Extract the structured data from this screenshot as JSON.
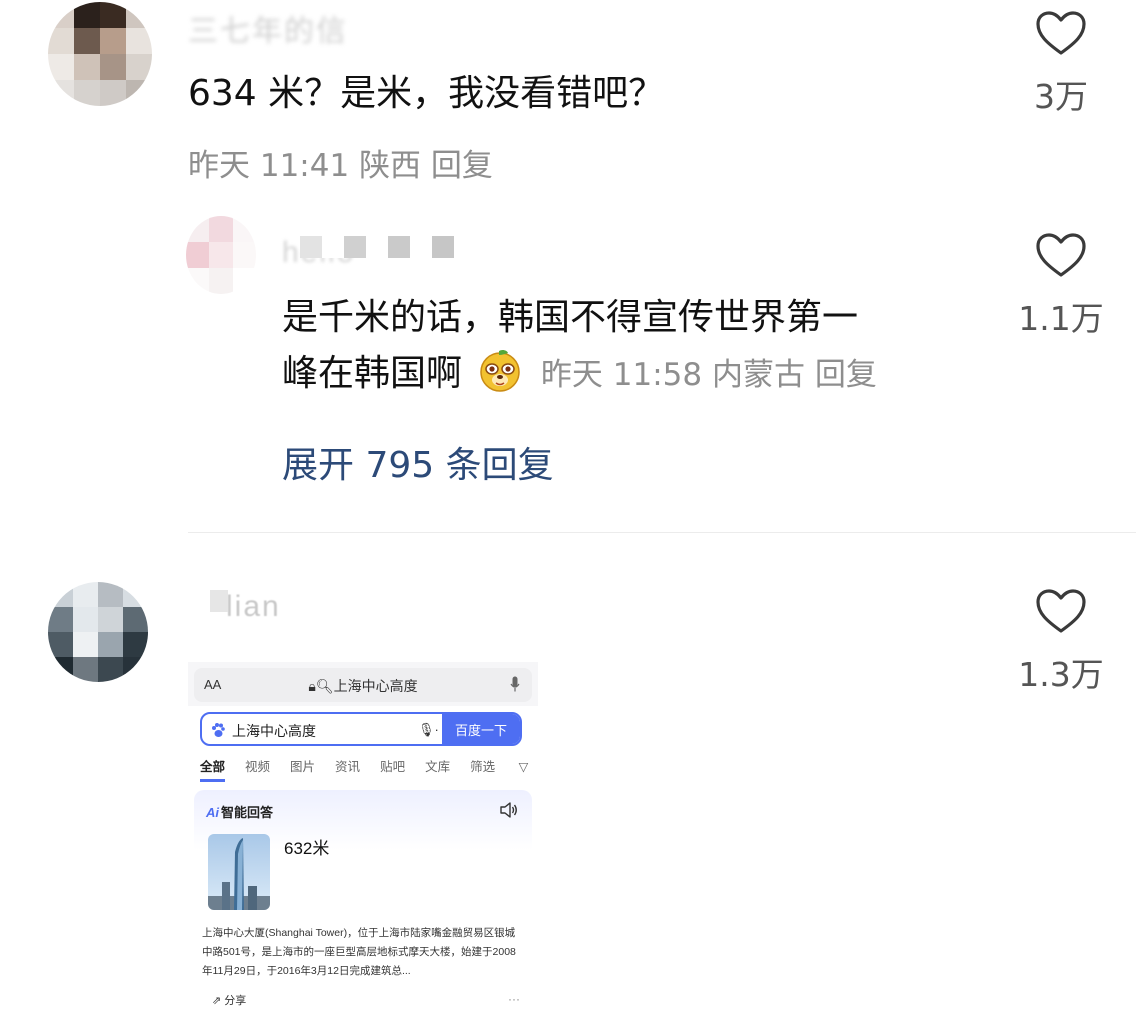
{
  "comments": [
    {
      "username": "三七年的信",
      "text": "634 米？是米，我没看错吧？",
      "time": "昨天 11:41",
      "location": "陕西",
      "reply_label": "回复",
      "likes": "3万"
    }
  ],
  "reply": {
    "username": "hello",
    "text_line1": "是千米的话，韩国不得宣传世界第一",
    "text_line2": "峰在韩国啊",
    "emoji": "dog-face-emoji",
    "time": "昨天 11:58",
    "location": "内蒙古",
    "reply_label": "回复",
    "likes": "1.1万",
    "expand_label": "展开 795 条回复"
  },
  "comment2": {
    "username": "lian",
    "likes": "1.3万",
    "image": {
      "address_aa": "AA",
      "address_url": "上海中心高度",
      "search_query": "上海中心高度",
      "search_button": "百度一下",
      "tabs": [
        "全部",
        "视频",
        "图片",
        "资讯",
        "贴吧",
        "文库"
      ],
      "filter_label": "筛选",
      "ai_badge": "Ai",
      "ai_title": "智能回答",
      "answer": "632米",
      "description": "上海中心大厦(Shanghai Tower)，位于上海市陆家嘴金融贸易区银城中路501号，是上海市的一座巨型高层地标式摩天大楼，始建于2008年11月29日，于2016年3月12日完成建筑总...",
      "share_label": "分享",
      "more_label": "···"
    }
  },
  "colors": {
    "link": "#2c4a78",
    "meta": "#8e8e8e",
    "baidu_blue": "#4e6ef2"
  }
}
